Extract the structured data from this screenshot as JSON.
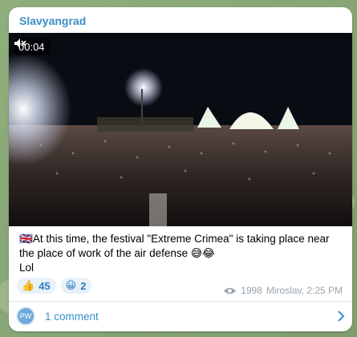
{
  "channel": {
    "name": "Slavyangrad"
  },
  "video": {
    "time": "00:04",
    "mute_icon": "muted-speaker-icon"
  },
  "message": {
    "flag": "🇬🇧",
    "line1": "At this time, the festival \"Extreme Crimea\" is taking place near",
    "line2": "the place of work of the air defense 😅😂",
    "line3": "Lol"
  },
  "reactions": [
    {
      "emoji": "👍",
      "count": "45"
    },
    {
      "emoji": "😀",
      "count": "2"
    }
  ],
  "meta": {
    "views": "1998",
    "author_time": "Miroslav, 2:25 PM"
  },
  "comments": {
    "avatar": "PW",
    "label": "1 comment"
  },
  "colors": {
    "accent": "#3a8fc8",
    "reaction_bg": "#e8f1fa"
  }
}
